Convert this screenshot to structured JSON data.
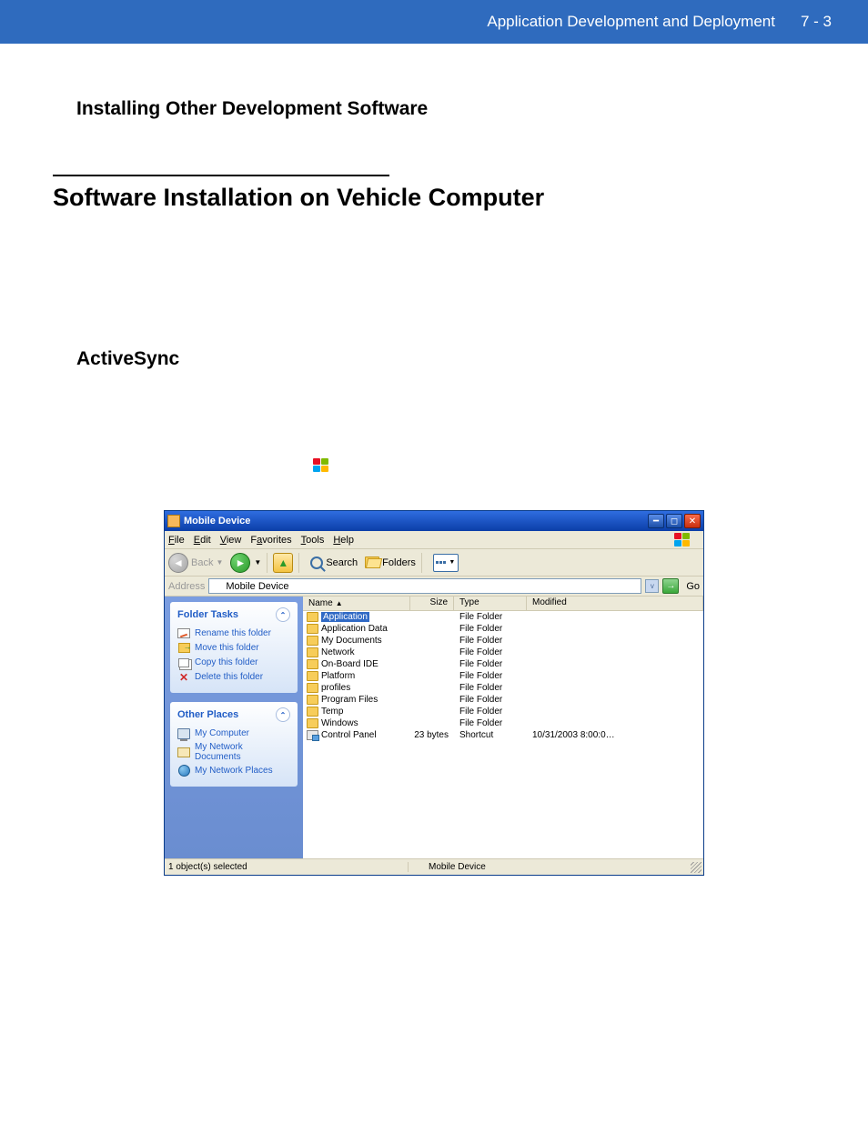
{
  "header": {
    "title": "Application Development and Deployment",
    "page": "7 - 3"
  },
  "sections": {
    "h2a": "Installing Other Development Software",
    "h1": "Software Installation on Vehicle Computer",
    "h2b": "ActiveSync"
  },
  "explorer": {
    "title": "Mobile Device",
    "menu": {
      "file": "File",
      "edit": "Edit",
      "view": "View",
      "favorites": "Favorites",
      "tools": "Tools",
      "help": "Help"
    },
    "toolbar": {
      "back": "Back",
      "search": "Search",
      "folders": "Folders"
    },
    "address": {
      "label": "Address",
      "value": "Mobile Device",
      "go": "Go"
    },
    "sidebar": {
      "folder_tasks": {
        "title": "Folder Tasks",
        "items": [
          {
            "label": "Rename this folder"
          },
          {
            "label": "Move this folder"
          },
          {
            "label": "Copy this folder"
          },
          {
            "label": "Delete this folder"
          }
        ]
      },
      "other_places": {
        "title": "Other Places",
        "items": [
          {
            "label": "My Computer"
          },
          {
            "label": "My Network Documents"
          },
          {
            "label": "My Network Places"
          }
        ]
      }
    },
    "columns": {
      "name": "Name",
      "size": "Size",
      "type": "Type",
      "modified": "Modified"
    },
    "rows": [
      {
        "name": "Application",
        "size": "",
        "type": "File Folder",
        "modified": "",
        "selected": true,
        "icon": "folder"
      },
      {
        "name": "Application Data",
        "size": "",
        "type": "File Folder",
        "modified": "",
        "icon": "folder"
      },
      {
        "name": "My Documents",
        "size": "",
        "type": "File Folder",
        "modified": "",
        "icon": "folder"
      },
      {
        "name": "Network",
        "size": "",
        "type": "File Folder",
        "modified": "",
        "icon": "folder"
      },
      {
        "name": "On-Board IDE",
        "size": "",
        "type": "File Folder",
        "modified": "",
        "icon": "folder"
      },
      {
        "name": "Platform",
        "size": "",
        "type": "File Folder",
        "modified": "",
        "icon": "folder"
      },
      {
        "name": "profiles",
        "size": "",
        "type": "File Folder",
        "modified": "",
        "icon": "folder"
      },
      {
        "name": "Program Files",
        "size": "",
        "type": "File Folder",
        "modified": "",
        "icon": "folder"
      },
      {
        "name": "Temp",
        "size": "",
        "type": "File Folder",
        "modified": "",
        "icon": "folder"
      },
      {
        "name": "Windows",
        "size": "",
        "type": "File Folder",
        "modified": "",
        "icon": "folder"
      },
      {
        "name": "Control Panel",
        "size": "23 bytes",
        "type": "Shortcut",
        "modified": "10/31/2003  8:00:0…",
        "icon": "cp"
      }
    ],
    "status": {
      "left": "1 object(s) selected",
      "right": "Mobile Device"
    }
  }
}
